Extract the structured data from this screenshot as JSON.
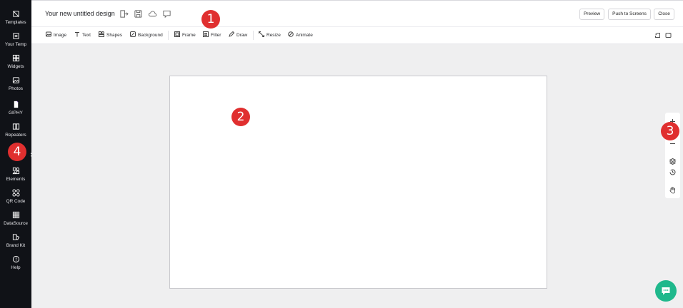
{
  "header": {
    "title": "Your new untitled design",
    "icons": [
      "share-icon",
      "save-icon",
      "cloud-icon",
      "comment-icon"
    ],
    "buttons": {
      "preview": "Preview",
      "push": "Push to Screens",
      "close": "Close"
    }
  },
  "sidebar": {
    "items": [
      {
        "label": "Templates",
        "icon": "templates-icon"
      },
      {
        "label": "Your Temp",
        "icon": "your-templates-icon"
      },
      {
        "label": "Widgets",
        "icon": "widgets-icon"
      },
      {
        "label": "Photos",
        "icon": "photos-icon"
      },
      {
        "label": "GIPHY",
        "icon": "giphy-icon"
      },
      {
        "label": "Repeaters",
        "icon": "repeaters-icon"
      },
      {
        "label": "Elements",
        "icon": "elements-icon"
      },
      {
        "label": "QR Code",
        "icon": "qr-code-icon"
      },
      {
        "label": "DataSource",
        "icon": "datasource-icon"
      },
      {
        "label": "Brand Kit",
        "icon": "brand-kit-icon"
      },
      {
        "label": "Help",
        "icon": "help-icon"
      }
    ]
  },
  "toolbar": {
    "tools": [
      {
        "label": "Image",
        "icon": "image-icon"
      },
      {
        "label": "Text",
        "icon": "text-icon"
      },
      {
        "label": "Shapes",
        "icon": "shapes-icon"
      },
      {
        "label": "Background",
        "icon": "background-icon"
      },
      {
        "label": "Frame",
        "icon": "frame-icon"
      },
      {
        "label": "Filter",
        "icon": "filter-icon"
      },
      {
        "label": "Draw",
        "icon": "pencil-icon"
      },
      {
        "label": "Resize",
        "icon": "resize-icon"
      },
      {
        "label": "Animate",
        "icon": "animate-icon"
      }
    ],
    "right_icons": [
      "undo-icon",
      "redo-icon"
    ]
  },
  "zoom_panel": {
    "icons": [
      "zoom-in-icon",
      "zoom-out-icon",
      "layers-icon",
      "history-icon",
      "hand-icon"
    ]
  },
  "annotations": [
    "1",
    "2",
    "3",
    "4"
  ],
  "colors": {
    "sidebar_bg": "#101217",
    "badge": "#e02f2f",
    "chat": "#1fb88c"
  }
}
